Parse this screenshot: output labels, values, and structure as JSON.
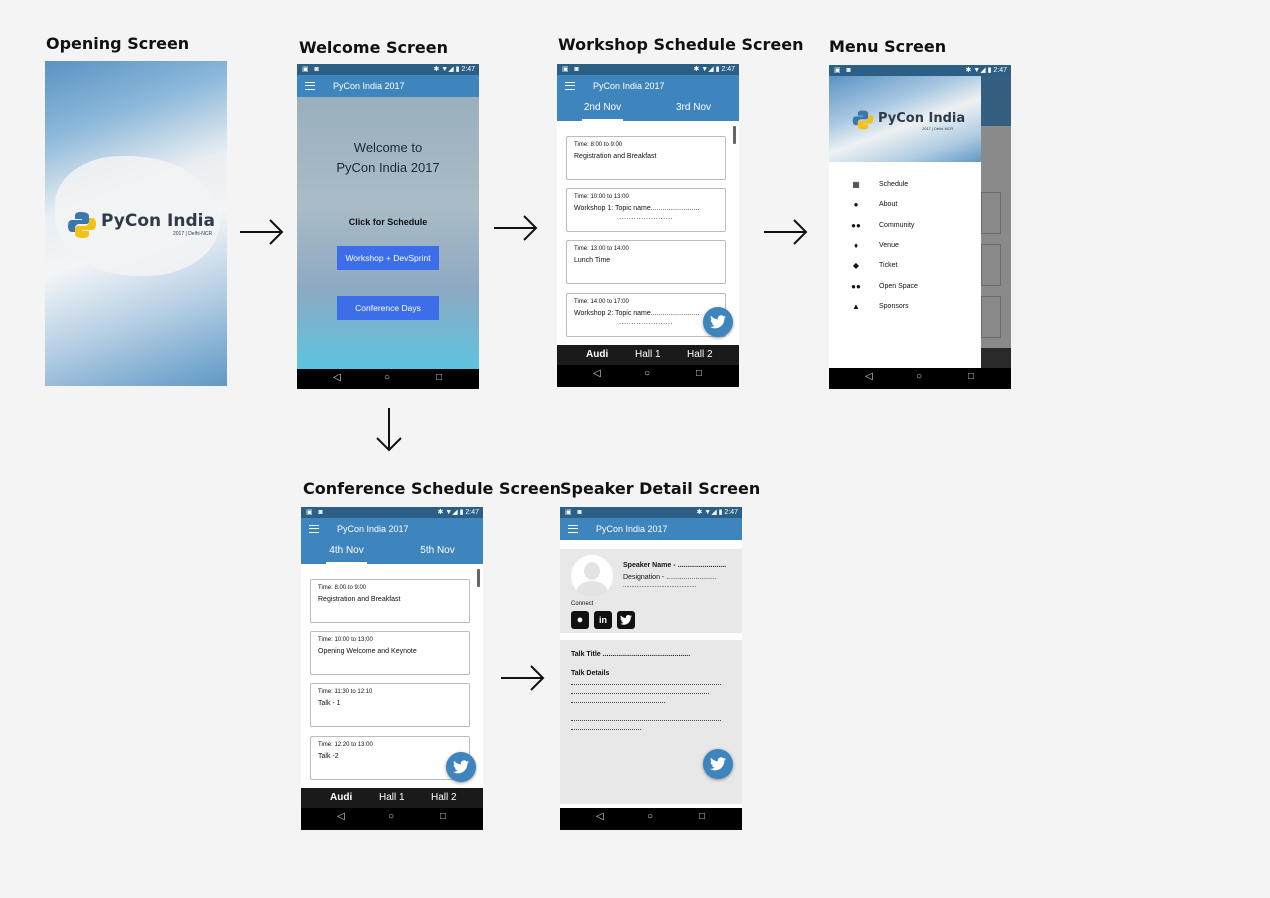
{
  "screens": {
    "opening": {
      "label": "Opening Screen",
      "logo": "PyCon India",
      "logo_sub": "2017 | Delhi-NCR"
    },
    "welcome": {
      "label": "Welcome Screen",
      "app_title": "PyCon India 2017",
      "heading_1": "Welcome to",
      "heading_2": "PyCon India 2017",
      "prompt": "Click for Schedule",
      "button_workshop": "Workshop + DevSprint",
      "button_conference": "Conference Days"
    },
    "workshop": {
      "label": "Workshop Schedule Screen",
      "app_title": "PyCon India 2017",
      "tabs": [
        "2nd Nov",
        "3rd Nov"
      ],
      "cards": [
        {
          "time": "Time: 8:00 to 9:00",
          "name": "Registration and Breakfast",
          "extra": ""
        },
        {
          "time": "Time: 10:00 to 13:00",
          "name": "Workshop 1: Topic name.........................",
          "extra": "......................"
        },
        {
          "time": "Time: 13:00 to 14:00",
          "name": "Lunch Time",
          "extra": ""
        },
        {
          "time": "Time: 14:00 to 17:00",
          "name": "Workshop 2: Topic name.........................",
          "extra": "......................"
        }
      ],
      "halls": [
        "Audi",
        "Hall 1",
        "Hall 2"
      ]
    },
    "menu": {
      "label": "Menu Screen",
      "logo": "PyCon India",
      "logo_sub": "2017 | Delhi-NCR",
      "items": [
        "Schedule",
        "About",
        "Community",
        "Venue",
        "Ticket",
        "Open Space",
        "Sponsors"
      ]
    },
    "conference": {
      "label": "Conference Schedule Screen",
      "app_title": "PyCon India 2017",
      "tabs": [
        "4th Nov",
        "5th Nov"
      ],
      "cards": [
        {
          "time": "Time: 8:00 to 9:00",
          "name": "Registration and Breakfast"
        },
        {
          "time": "Time: 10:00 to 13:00",
          "name": "Opening Welcome and Keynote"
        },
        {
          "time": "Time: 11:30 to 12:10",
          "name": "Talk - 1"
        },
        {
          "time": "Time: 12:20 to 13:00",
          "name": "Talk -2"
        }
      ],
      "halls": [
        "Audi",
        "Hall 1",
        "Hall 2"
      ]
    },
    "speaker": {
      "label": "Speaker Detail Screen",
      "app_title": "PyCon India 2017",
      "speaker_name": "Speaker Name - .........................",
      "designation": "Designation - ..........................",
      "designation_cont": "............................................",
      "connect": "Connect",
      "talk_title": "Talk Title .............................................",
      "talk_details": "Talk Details"
    }
  },
  "status_time": "2:47",
  "colors": {
    "primary": "#3f85bd",
    "status": "#2b5f86",
    "button": "#3b6ee8"
  }
}
